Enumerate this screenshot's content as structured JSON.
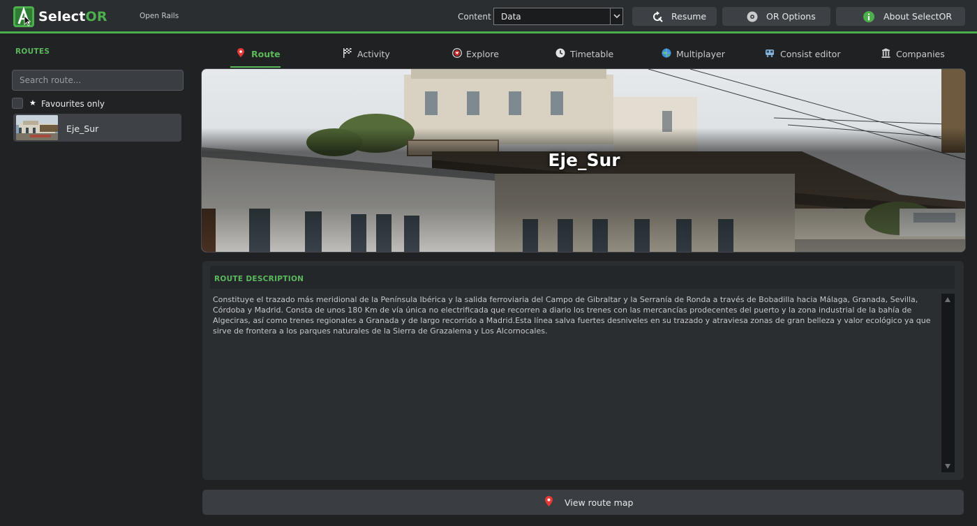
{
  "app": {
    "brand_main": "Select",
    "brand_accent": "OR",
    "subtitle": "Open Rails",
    "accent_color": "#4cae4c"
  },
  "header": {
    "content_label": "Content",
    "content_value": "Data",
    "resume_label": "Resume",
    "options_label": "OR Options",
    "about_label": "About SelectOR"
  },
  "sidebar": {
    "title": "ROUTES",
    "search_placeholder": "Search route...",
    "favourites_star": "★",
    "favourites_label": "Favourites only",
    "routes": [
      {
        "name": "Eje_Sur"
      }
    ]
  },
  "tabs": [
    {
      "label": "Route",
      "icon": "pin-icon",
      "active": true
    },
    {
      "label": "Activity",
      "icon": "checkered-flag-icon"
    },
    {
      "label": "Explore",
      "icon": "explore-icon"
    },
    {
      "label": "Timetable",
      "icon": "clock-icon"
    },
    {
      "label": "Multiplayer",
      "icon": "globe-icon"
    },
    {
      "label": "Consist editor",
      "icon": "train-icon"
    },
    {
      "label": "Companies",
      "icon": "building-icon"
    }
  ],
  "route": {
    "title": "Eje_Sur",
    "description_title": "ROUTE DESCRIPTION",
    "description": "Constituye el trazado más meridional de la Península Ibérica y la salida ferroviaria del Campo de Gibraltar y la Serranía de Ronda a través de Bobadilla hacia Málaga, Granada, Sevilla, Córdoba y Madrid. Consta de unos 180 Km de vía única no electrificada que recorren a diario los trenes con las mercancías prodecentes del puerto y la zona industrial de la bahía de Algeciras, así como trenes regionales a Granada y de largo recorrido a Madrid.Esta línea salva fuertes desniveles en su trazado y atraviesa zonas de gran belleza y valor ecológico ya que sirve de frontera a los parques naturales de la Sierra de Grazalema y Los Alcornocales.",
    "map_button_label": "View route map"
  }
}
